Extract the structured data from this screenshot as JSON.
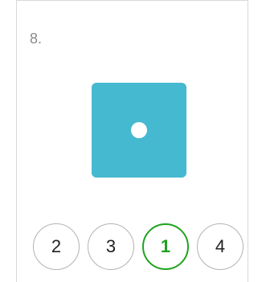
{
  "question": {
    "number_label": "8."
  },
  "die": {
    "color": "#45b9cf",
    "pip_color": "#ffffff",
    "pips": 1
  },
  "options": [
    {
      "label": "2",
      "state": "default"
    },
    {
      "label": "3",
      "state": "default"
    },
    {
      "label": "1",
      "state": "correct"
    },
    {
      "label": "4",
      "state": "default"
    }
  ],
  "colors": {
    "correct": "#1fa31f",
    "option_border": "#b3b3b3",
    "question_text": "#8a8a8a"
  }
}
